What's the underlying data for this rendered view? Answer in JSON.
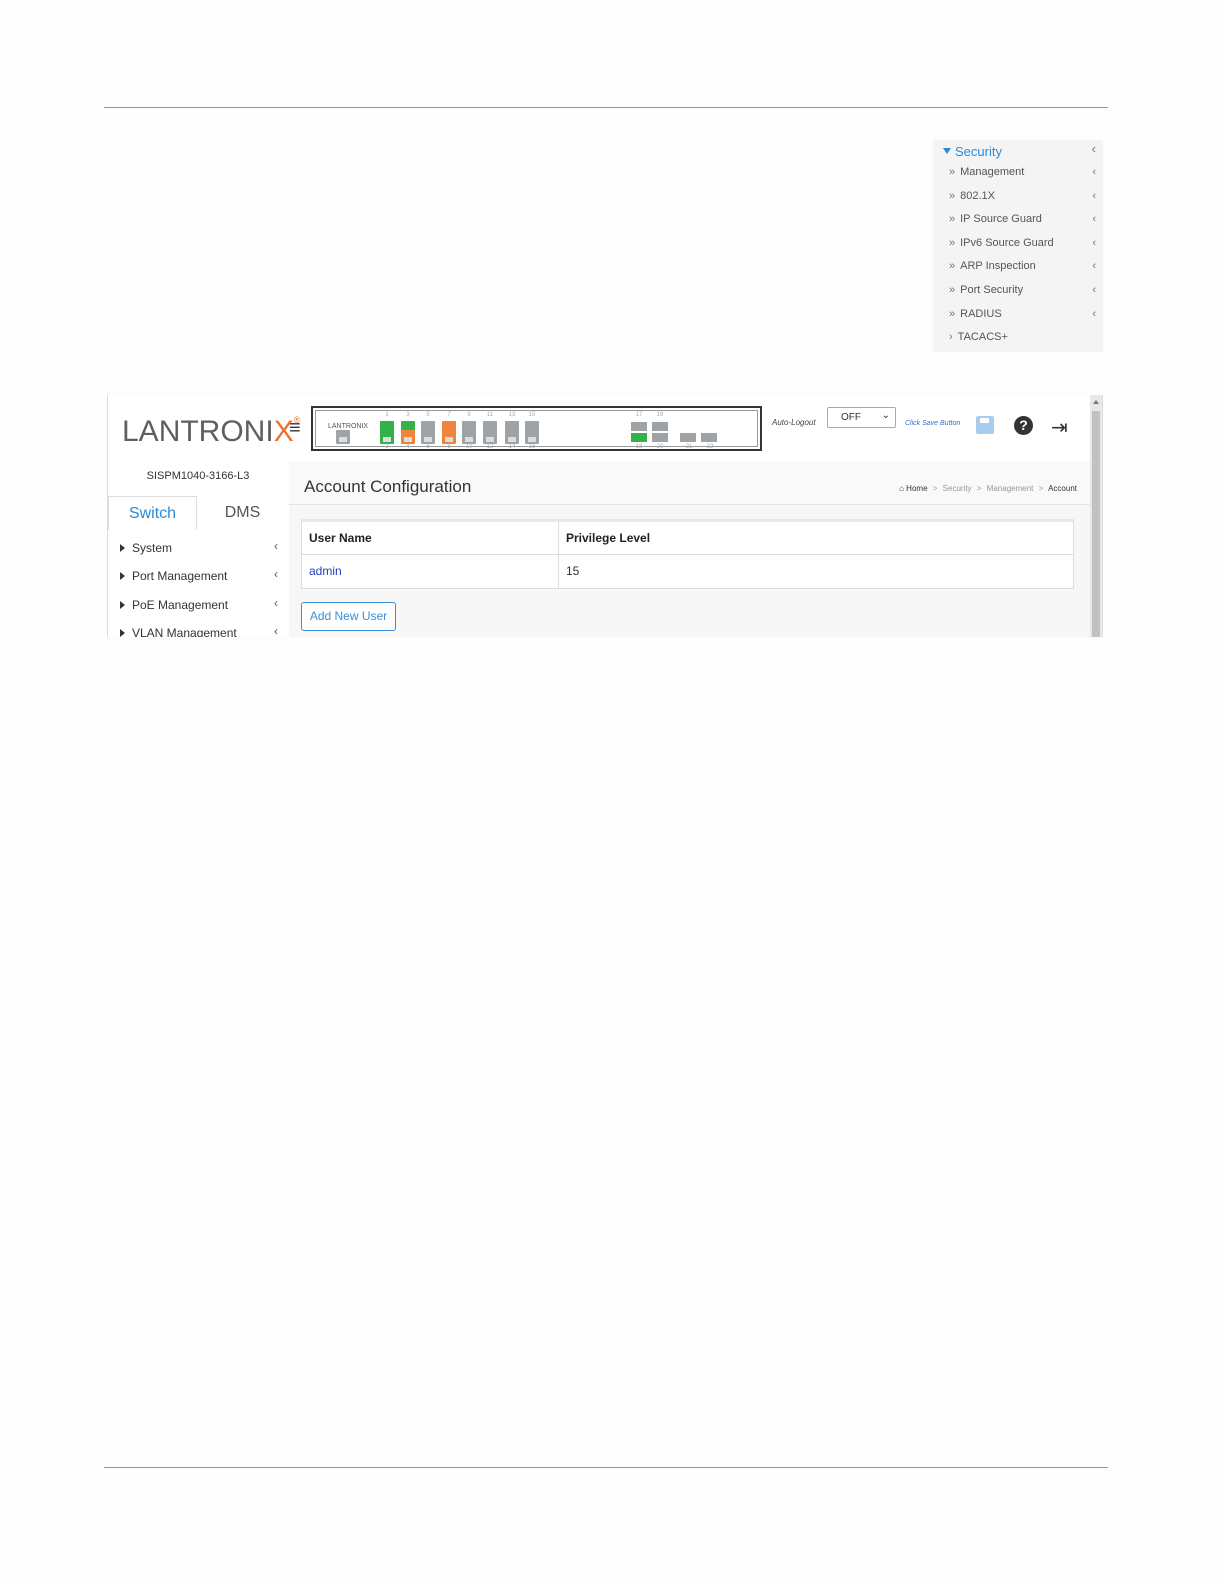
{
  "security_menu": {
    "header": "Security",
    "items": [
      {
        "label": "Management",
        "prefix": "»",
        "has_chevron": true
      },
      {
        "label": "802.1X",
        "prefix": "»",
        "has_chevron": true
      },
      {
        "label": "IP Source Guard",
        "prefix": "»",
        "has_chevron": true
      },
      {
        "label": "IPv6 Source Guard",
        "prefix": "»",
        "has_chevron": true
      },
      {
        "label": "ARP Inspection",
        "prefix": "»",
        "has_chevron": true
      },
      {
        "label": "Port Security",
        "prefix": "»",
        "has_chevron": true
      },
      {
        "label": "RADIUS",
        "prefix": "»",
        "has_chevron": true
      },
      {
        "label": "TACACS+",
        "prefix": "›",
        "has_chevron": false
      }
    ],
    "chevron": "‹"
  },
  "header": {
    "logo": {
      "main": "LANTRONI",
      "accent": "X",
      "reg": "®"
    },
    "panel_logo": "LANTRONIX",
    "port_numbers_top": [
      "1",
      "3",
      "5",
      "7",
      "9",
      "11",
      "13",
      "15",
      "17",
      "19"
    ],
    "port_numbers_bottom": [
      "2",
      "4",
      "6",
      "8",
      "10",
      "12",
      "14",
      "16",
      "18",
      "20",
      "21",
      "22"
    ],
    "auto_logout_label": "Auto-Logout",
    "auto_logout_value": "OFF",
    "save_link": "Click Save Button",
    "help_glyph": "?",
    "logout_glyph": "⇥"
  },
  "sidebar": {
    "model": "SISPM1040-3166-L3",
    "tabs": [
      "Switch",
      "DMS"
    ],
    "items": [
      {
        "label": "System"
      },
      {
        "label": "Port Management"
      },
      {
        "label": "PoE Management"
      },
      {
        "label": "VLAN Management"
      }
    ],
    "chevron": "‹"
  },
  "main": {
    "title": "Account Configuration",
    "breadcrumb": {
      "home": "Home",
      "path": [
        "Security",
        "Management"
      ],
      "current": "Account",
      "separator": ">"
    },
    "table": {
      "columns": [
        "User Name",
        "Privilege Level"
      ],
      "rows": [
        [
          "admin",
          "15"
        ]
      ]
    },
    "add_button": "Add New User"
  },
  "colors": {
    "accent_orange": "#e37b3b",
    "link_blue": "#2d8ad4",
    "port_green": "#2fb34a",
    "port_orange": "#f0843b"
  }
}
